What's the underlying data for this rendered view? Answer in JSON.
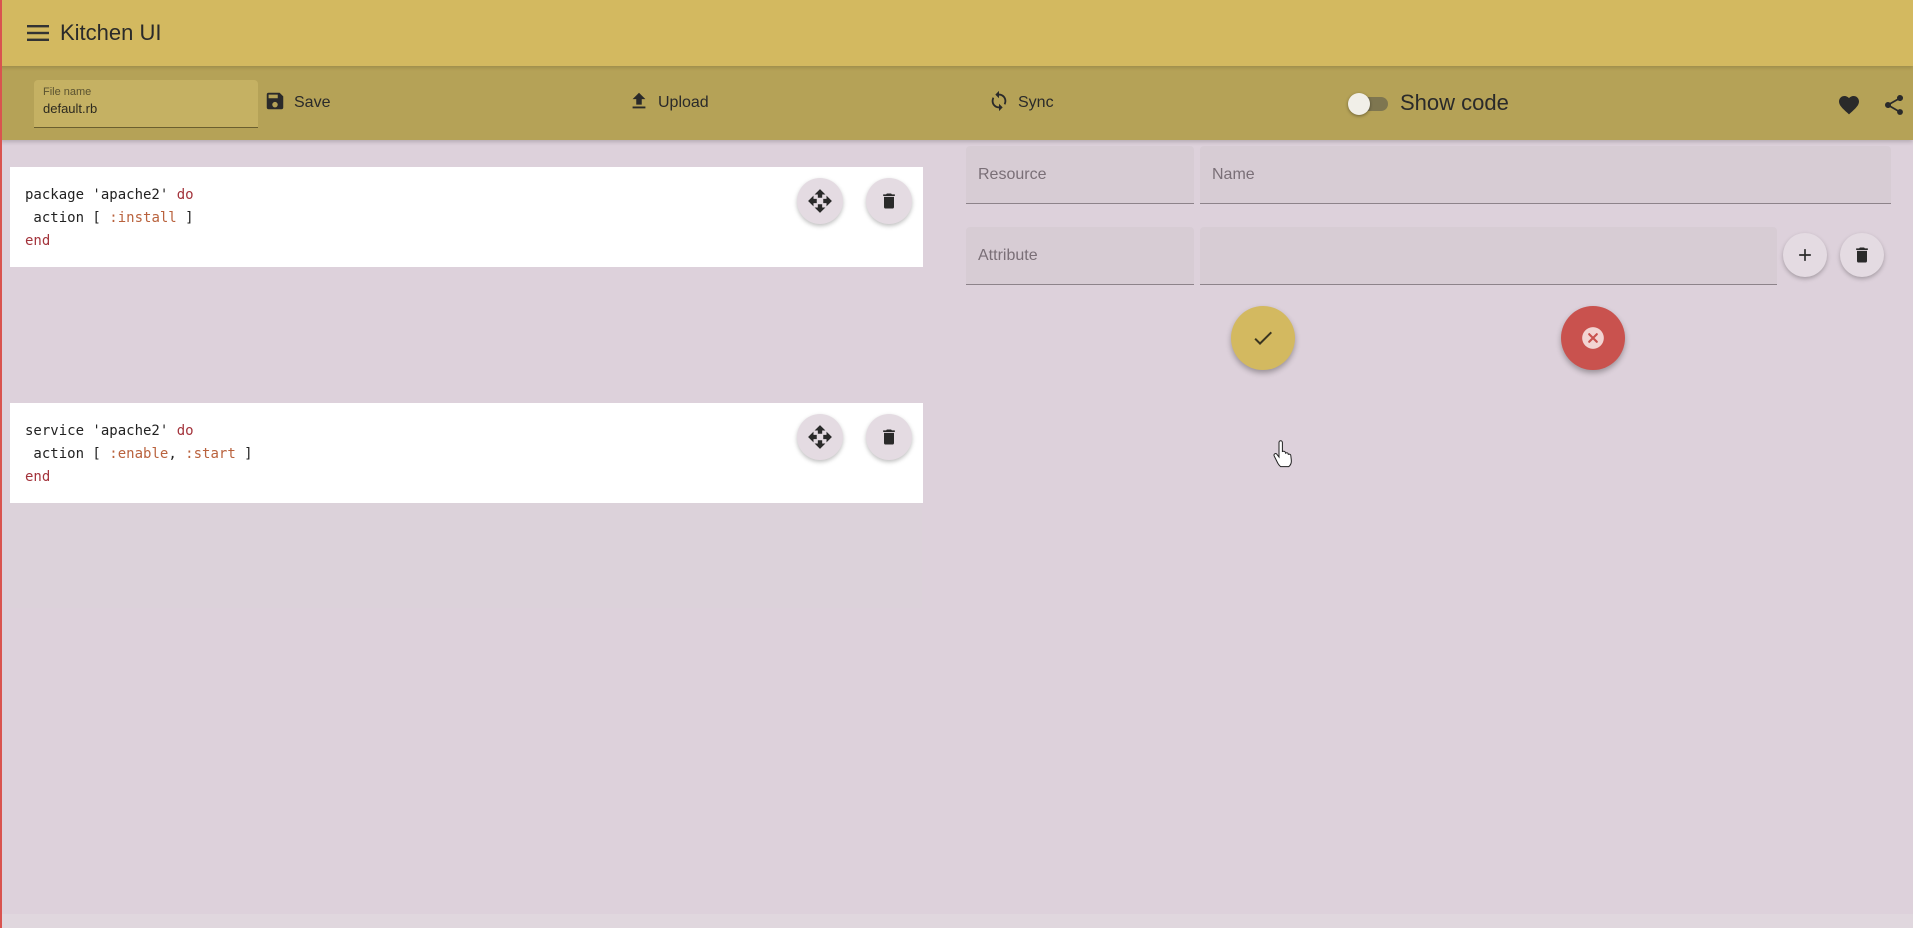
{
  "app": {
    "title": "Kitchen UI"
  },
  "toolbar": {
    "file_name_label": "File name",
    "file_name_value": "default.rb",
    "save_label": "Save",
    "upload_label": "Upload",
    "sync_label": "Sync",
    "show_code_label": "Show code",
    "show_code_on": false
  },
  "cards": [
    {
      "lines": [
        {
          "parts": [
            {
              "t": "package 'apache2' ",
              "c": "plain"
            },
            {
              "t": "do",
              "c": "kw"
            }
          ]
        },
        {
          "parts": [
            {
              "t": " action [ ",
              "c": "plain"
            },
            {
              "t": ":install",
              "c": "sym"
            },
            {
              "t": " ]",
              "c": "plain"
            }
          ]
        },
        {
          "parts": [
            {
              "t": "end",
              "c": "kw"
            }
          ]
        }
      ]
    },
    {
      "lines": [
        {
          "parts": [
            {
              "t": "service 'apache2' ",
              "c": "plain"
            },
            {
              "t": "do",
              "c": "kw"
            }
          ]
        },
        {
          "parts": [
            {
              "t": " action [ ",
              "c": "plain"
            },
            {
              "t": ":enable",
              "c": "sym"
            },
            {
              "t": ", ",
              "c": "plain"
            },
            {
              "t": ":start",
              "c": "sym"
            },
            {
              "t": " ]",
              "c": "plain"
            }
          ]
        },
        {
          "parts": [
            {
              "t": "end",
              "c": "kw"
            }
          ]
        }
      ]
    }
  ],
  "form": {
    "resource_placeholder": "Resource",
    "name_placeholder": "Name",
    "attribute_placeholder": "Attribute",
    "value_placeholder": ""
  },
  "icons": {
    "menu": "menu-icon",
    "save": "floppy-icon",
    "upload": "upload-icon",
    "sync": "sync-icon",
    "heart": "heart-icon",
    "share": "share-icon",
    "move": "move-icon",
    "trash": "trash-icon",
    "plus": "plus-icon",
    "check": "check-icon",
    "cancel": "cancel-icon"
  },
  "colors": {
    "appbar": "#d3b960",
    "toolbar": "#b5a257",
    "background": "#ddd1db",
    "keyword": "#a3333b",
    "symbol": "#b9623d",
    "confirm": "#d3b960",
    "cancel": "#c9524e"
  }
}
